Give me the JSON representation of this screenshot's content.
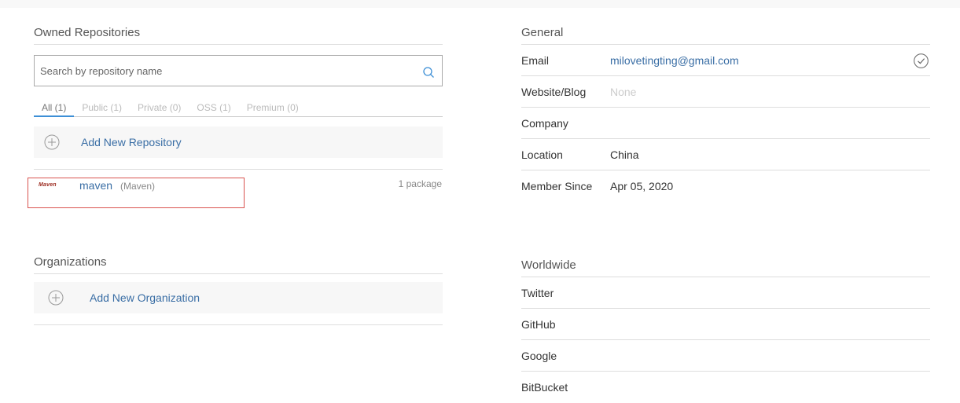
{
  "owned_repositories": {
    "title": "Owned Repositories",
    "search_placeholder": "Search by repository name",
    "tabs": [
      {
        "label": "All (1)",
        "active": true
      },
      {
        "label": "Public (1)",
        "active": false
      },
      {
        "label": "Private (0)",
        "active": false
      },
      {
        "label": "OSS (1)",
        "active": false
      },
      {
        "label": "Premium (0)",
        "active": false
      }
    ],
    "add_label": "Add New Repository",
    "repositories": [
      {
        "logo_text": "Maven",
        "name": "maven",
        "type": "(Maven)",
        "count": "1 package"
      }
    ]
  },
  "organizations": {
    "title": "Organizations",
    "add_label": "Add New Organization"
  },
  "general": {
    "title": "General",
    "rows": [
      {
        "key": "Email",
        "value": "milovetingting@gmail.com"
      },
      {
        "key": "Website/Blog",
        "value": "None"
      },
      {
        "key": "Company",
        "value": ""
      },
      {
        "key": "Location",
        "value": "China"
      },
      {
        "key": "Member Since",
        "value": "Apr 05, 2020"
      }
    ]
  },
  "worldwide": {
    "title": "Worldwide",
    "rows": [
      {
        "key": "Twitter"
      },
      {
        "key": "GitHub"
      },
      {
        "key": "Google"
      },
      {
        "key": "BitBucket"
      }
    ]
  },
  "colors": {
    "link": "#3a6ea5",
    "tab_active_underline": "#3d8fd6",
    "highlight_border": "#d9534f"
  },
  "icons": {
    "search": "search-icon",
    "add": "plus-circle-icon",
    "verified": "check-circle-icon"
  }
}
